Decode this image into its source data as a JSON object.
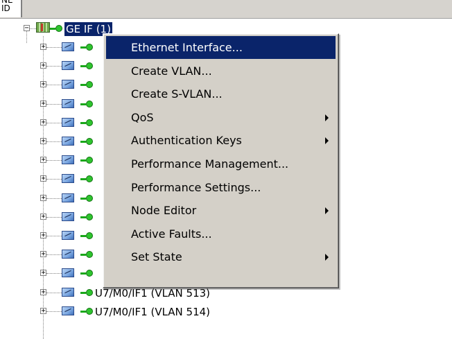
{
  "window": {
    "tab_label": "NE ID"
  },
  "tree": {
    "root": {
      "label": "GE IF (1)",
      "expander": "−"
    },
    "child_expander": "+",
    "visible_child_labels": [
      "U7/M0/IF1 (VLAN 513)",
      "U7/M0/IF1 (VLAN 514)"
    ]
  },
  "context_menu": {
    "items": [
      {
        "label": "Ethernet Interface...",
        "submenu": false,
        "active": true
      },
      {
        "label": "Create VLAN...",
        "submenu": false,
        "active": false
      },
      {
        "label": "Create S-VLAN...",
        "submenu": false,
        "active": false
      },
      {
        "label": "QoS",
        "submenu": true,
        "active": false
      },
      {
        "label": "Authentication Keys",
        "submenu": true,
        "active": false
      },
      {
        "label": "Performance Management...",
        "submenu": false,
        "active": false
      },
      {
        "label": "Performance Settings...",
        "submenu": false,
        "active": false
      },
      {
        "label": "Node Editor",
        "submenu": true,
        "active": false
      },
      {
        "label": "Active Faults...",
        "submenu": false,
        "active": false
      },
      {
        "label": "Set State",
        "submenu": true,
        "active": false
      }
    ]
  },
  "colors": {
    "selection": "#0a246a",
    "menu_background": "#d4d0c8",
    "status_green": "#2ec42e"
  },
  "icons": {
    "root_node": "network-element-icon",
    "child_node": "interface-icon",
    "status": "status-ok-icon",
    "submenu": "submenu-arrow-icon"
  }
}
